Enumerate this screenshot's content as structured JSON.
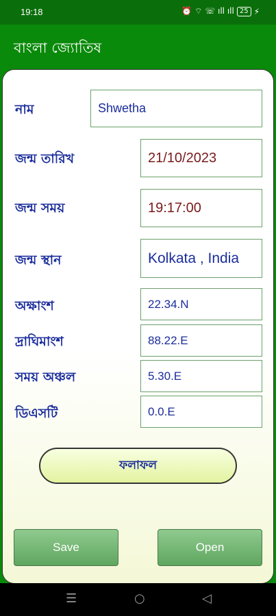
{
  "status": {
    "time": "19:18",
    "icons_text": "⏰ ⌔ ☏ ıll ıll",
    "battery": "25"
  },
  "app": {
    "title": "বাংলা জ্যোতিষ"
  },
  "form": {
    "name_label": "নাম",
    "name_value": "Shwetha",
    "dob_label": "জন্ম তারিখ",
    "dob_value": "21/10/2023",
    "tob_label": "জন্ম সময়",
    "tob_value": "19:17:00",
    "pob_label": "জন্ম স্থান",
    "pob_value": "Kolkata , India",
    "lat_label": "অক্ষাংশ",
    "lat_value": "22.34.N",
    "lon_label": "দ্রাঘিমাংশ",
    "lon_value": "88.22.E",
    "tz_label": "সময় অঞ্চল",
    "tz_value": "5.30.E",
    "dst_label": "ডিএসটি",
    "dst_value": "0.0.E"
  },
  "buttons": {
    "result": "ফলাফল",
    "save": "Save",
    "open": "Open"
  },
  "nav": {
    "menu": "☰",
    "home": "○",
    "back": "◁"
  },
  "colors": {
    "appbar": "#0a8a0a",
    "label": "#1a2c9c",
    "date_value": "#7a1a1a"
  }
}
